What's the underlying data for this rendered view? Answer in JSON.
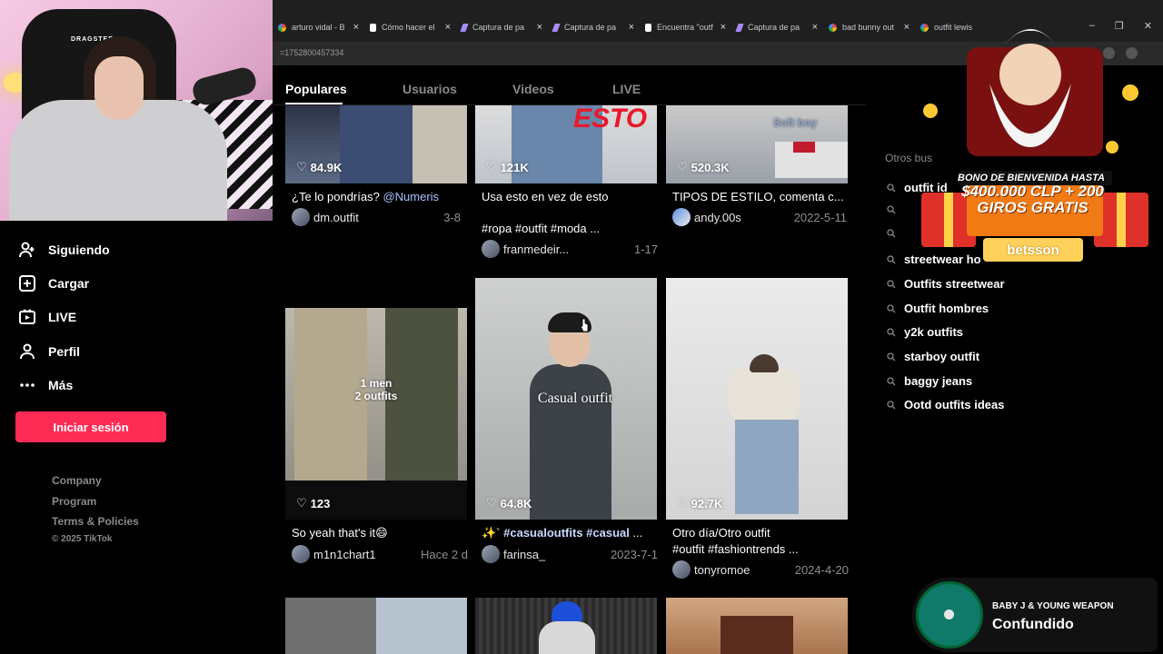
{
  "browser": {
    "tabs": [
      {
        "icon": "google",
        "label": "arturo vidal - B"
      },
      {
        "icon": "tiktok",
        "label": "Cómo hacer el"
      },
      {
        "icon": "capture",
        "label": "Captura de pa"
      },
      {
        "icon": "capture",
        "label": "Captura de pa"
      },
      {
        "icon": "tiktok",
        "label": "Encuentra \"outf"
      },
      {
        "icon": "capture",
        "label": "Captura de pa"
      },
      {
        "icon": "google",
        "label": "bad bunny out"
      },
      {
        "icon": "google",
        "label": "outfit lewis"
      }
    ],
    "url": "=1752800457334"
  },
  "webcam": {
    "chair_brand": "DRAGSTER"
  },
  "sidebar": {
    "nav": [
      {
        "label": "Siguiendo",
        "icon": "user-follow-icon"
      },
      {
        "label": "Cargar",
        "icon": "upload-icon"
      },
      {
        "label": "LIVE",
        "icon": "live-icon"
      },
      {
        "label": "Perfil",
        "icon": "profile-icon"
      },
      {
        "label": "Más",
        "icon": "more-icon"
      }
    ],
    "login_label": "Iniciar sesión",
    "footer": [
      "Company",
      "Program",
      "Terms & Policies"
    ],
    "copyright": "© 2025 TikTok"
  },
  "content_tabs": [
    "Populares",
    "Usuarios",
    "Videos",
    "LIVE"
  ],
  "videos": [
    {
      "likes": "84.9K",
      "caption": "¿Te lo pondrías? ",
      "mention": "@Numeris",
      "user": "dm.outfit",
      "date": "3-8"
    },
    {
      "likes": "121K",
      "caption": "Usa esto en vez de esto",
      "tags": "#ropa #outfit #moda",
      "tags_tail": " ...",
      "user": "franmedeir...",
      "date": "1-17",
      "overlay": "ESTO"
    },
    {
      "likes": "520.3K",
      "caption": "TIPOS DE ESTILO, comenta c...",
      "user": "andy.00s",
      "date": "2022-5-11",
      "overlay": "Soft boy"
    },
    {
      "likes": "123",
      "caption": "So yeah that's it",
      "emoji": "😄",
      "user": "m1n1chart1",
      "date": "Hace 2 d",
      "overlay": "1 men\n2 outfits"
    },
    {
      "likes": "64.8K",
      "prefix": "✨` ",
      "tags": "#casualoutfits #casual",
      "tags_tail": " ...",
      "user": "farinsa_",
      "date": "2023-7-1",
      "overlay": "Casual outfit"
    },
    {
      "likes": "92.7K",
      "caption": "Otro día/Otro outfit",
      "tags": "#outfit #fashiontrends",
      "tags_tail": " ...",
      "user": "tonyromoe",
      "date": "2024-4-20"
    }
  ],
  "right_panel": {
    "title": "Otros bus",
    "suggestions": [
      "outfit id",
      "",
      "",
      "streetwear ho",
      "Outfits streetwear",
      "Outfit hombres",
      "y2k outfits",
      "starboy outfit",
      "baggy jeans",
      "Ootd outfits ideas"
    ]
  },
  "ad": {
    "headline": "BONO DE BIENVENIDA HASTA",
    "offer": "$400.000 CLP + 200 GIROS GRATIS",
    "brand": "betsson"
  },
  "player": {
    "artist": "BABY J & YOUNG WEAPON",
    "song": "Confundido"
  },
  "colors": {
    "accent": "#fe2c55",
    "background": "#000000",
    "tag": "#c7d8ff"
  }
}
